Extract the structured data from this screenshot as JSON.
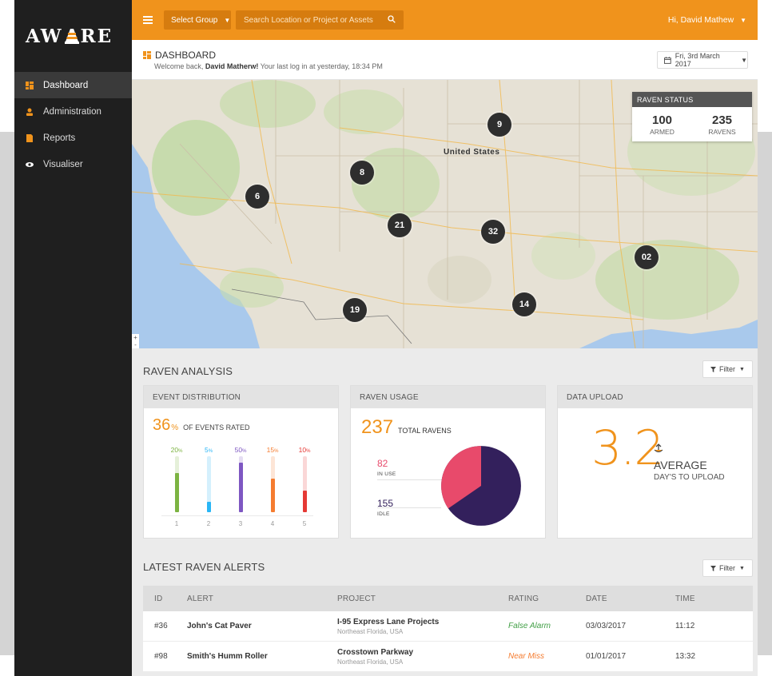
{
  "app": {
    "logo_text_left": "AW",
    "logo_text_right": "RE",
    "accent_color": "#f0931c"
  },
  "sidebar": {
    "items": [
      {
        "label": "Dashboard",
        "icon": "dashboard-icon",
        "active": true
      },
      {
        "label": "Administration",
        "icon": "user-icon",
        "active": false
      },
      {
        "label": "Reports",
        "icon": "document-icon",
        "active": false
      },
      {
        "label": "Visualiser",
        "icon": "eye-icon",
        "active": false
      }
    ]
  },
  "topbar": {
    "select_group_label": "Select Group",
    "search_placeholder": "Search Location or Project or Assets",
    "user_greeting": "Hi, David Mathew"
  },
  "page_header": {
    "title": "DASHBOARD",
    "welcome_prefix": "Welcome back,",
    "welcome_name": "David Matherw!",
    "welcome_suffix": "Your last log in at yesterday, 18:34 PM",
    "date_label": "Fri, 3rd March 2017"
  },
  "map": {
    "country_label": "United States",
    "clusters": [
      "9",
      "8",
      "6",
      "21",
      "32",
      "02",
      "19",
      "14"
    ],
    "zoom_in": "+",
    "zoom_out": "-"
  },
  "raven_status": {
    "title": "RAVEN STATUS",
    "armed_value": "100",
    "armed_label": "ARMED",
    "ravens_value": "235",
    "ravens_label": "RAVENS"
  },
  "analysis": {
    "title": "RAVEN ANALYSIS",
    "filter_label": "Filter",
    "event_distribution": {
      "title": "EVENT DISTRIBUTION",
      "value": "36",
      "unit": "%",
      "label": "OF EVENTS RATED",
      "bars": [
        {
          "index": "1",
          "pct": "20",
          "value": 0.7,
          "color": "#7cb342"
        },
        {
          "index": "2",
          "pct": "5",
          "value": 0.18,
          "color": "#29b6f6"
        },
        {
          "index": "3",
          "pct": "50",
          "value": 0.88,
          "color": "#7e57c2"
        },
        {
          "index": "4",
          "pct": "15",
          "value": 0.6,
          "color": "#f57c30"
        },
        {
          "index": "5",
          "pct": "10",
          "value": 0.38,
          "color": "#e53935"
        }
      ]
    },
    "raven_usage": {
      "title": "RAVEN USAGE",
      "total_value": "237",
      "total_label": "TOTAL RAVENS",
      "in_use_value": "82",
      "in_use_label": "IN USE",
      "idle_value": "155",
      "idle_label": "IDLE",
      "in_use_color": "#e84a6b",
      "idle_color": "#33205c"
    },
    "data_upload": {
      "title": "DATA UPLOAD",
      "value": "3.2",
      "label_main": "AVERAGE",
      "label_sub": "DAY'S TO UPLOAD"
    }
  },
  "alerts": {
    "title": "LATEST RAVEN ALERTS",
    "filter_label": "Filter",
    "columns": [
      "ID",
      "ALERT",
      "PROJECT",
      "RATING",
      "DATE",
      "TIME"
    ],
    "rows": [
      {
        "id": "#36",
        "alert": "John's Cat Paver",
        "project": "I-95 Express Lane Projects",
        "location": "Northeast Florida, USA",
        "rating": "False Alarm",
        "rating_color": "#43a047",
        "date": "03/03/2017",
        "time": "11:12"
      },
      {
        "id": "#98",
        "alert": "Smith's Humm Roller",
        "project": "Crosstown Parkway",
        "location": "Northeast Florida, USA",
        "rating": "Near Miss",
        "rating_color": "#f57c30",
        "date": "01/01/2017",
        "time": "13:32"
      }
    ]
  }
}
